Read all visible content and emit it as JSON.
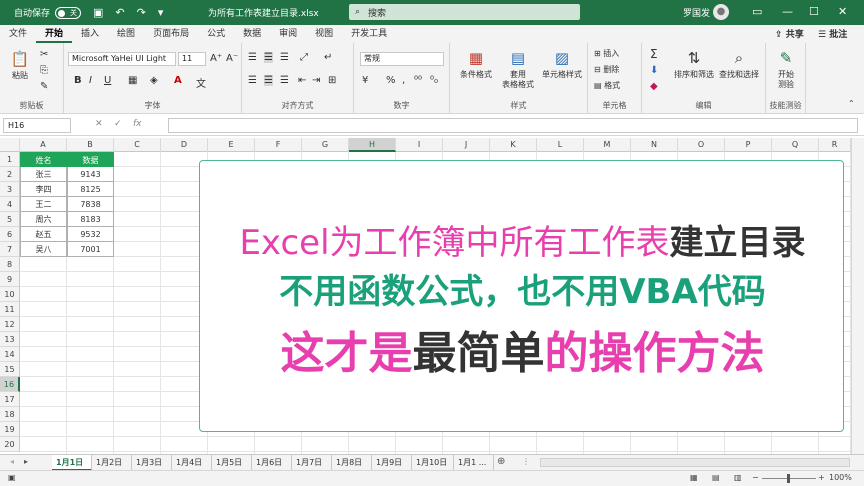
{
  "titlebar": {
    "autosave_label": "自动保存",
    "autosave_state": "关",
    "filename": "为所有工作表建立目录.xlsx",
    "search_placeholder": "搜索",
    "user": "罗国发"
  },
  "ribbon_tabs": [
    "文件",
    "开始",
    "插入",
    "绘图",
    "页面布局",
    "公式",
    "数据",
    "审阅",
    "视图",
    "开发工具"
  ],
  "share_label": "共享",
  "comment_label": "批注",
  "ribbon": {
    "clipboard": {
      "paste": "粘贴",
      "label": "剪贴板"
    },
    "font": {
      "name": "Microsoft YaHei UI Light",
      "size": "11",
      "label": "字体"
    },
    "alignment": {
      "label": "对齐方式"
    },
    "number": {
      "format": "常规",
      "label": "数字"
    },
    "styles": {
      "cond": "条件格式",
      "table_line1": "套用",
      "table_line2": "表格格式",
      "cell": "单元格样式",
      "label": "样式"
    },
    "cells": {
      "insert": "插入",
      "delete": "删除",
      "format": "格式",
      "label": "单元格"
    },
    "editing": {
      "sort": "排序和筛选",
      "find": "查找和选择",
      "label": "编辑"
    },
    "devtools": {
      "start_line1": "开始",
      "start_line2": "测验",
      "label": "技能测验"
    }
  },
  "namebox": "H16",
  "columns": [
    "A",
    "B",
    "C",
    "D",
    "E",
    "F",
    "G",
    "H",
    "I",
    "J",
    "K",
    "L",
    "M",
    "N",
    "O",
    "P",
    "Q",
    "R"
  ],
  "rows": [
    "1",
    "2",
    "3",
    "4",
    "5",
    "6",
    "7",
    "8",
    "9",
    "10",
    "11",
    "12",
    "13",
    "14",
    "15",
    "16",
    "17",
    "18",
    "19",
    "20"
  ],
  "table": {
    "headers": [
      "姓名",
      "数据"
    ],
    "rows": [
      [
        "张三",
        "9143"
      ],
      [
        "李四",
        "8125"
      ],
      [
        "王二",
        "7838"
      ],
      [
        "周六",
        "8183"
      ],
      [
        "赵五",
        "9532"
      ],
      [
        "吴八",
        "7001"
      ]
    ]
  },
  "overlay": {
    "line1_pink": "Excel为工作簿中所有工作表",
    "line1_dark": "建立目录",
    "line2": "不用函数公式，也不用VBA代码",
    "line3_pink1": "这才是",
    "line3_dark": "最简单",
    "line3_pink2": "的操作方法"
  },
  "sheets": [
    "1月1日",
    "1月2日",
    "1月3日",
    "1月4日",
    "1月5日",
    "1月6日",
    "1月7日",
    "1月8日",
    "1月9日",
    "1月10日",
    "1月1 ..."
  ],
  "status": {
    "zoom": "100%"
  },
  "colors": {
    "excel_green": "#217346",
    "pink": "#e83fae",
    "teal": "#1aa07a",
    "dark": "#333333"
  }
}
